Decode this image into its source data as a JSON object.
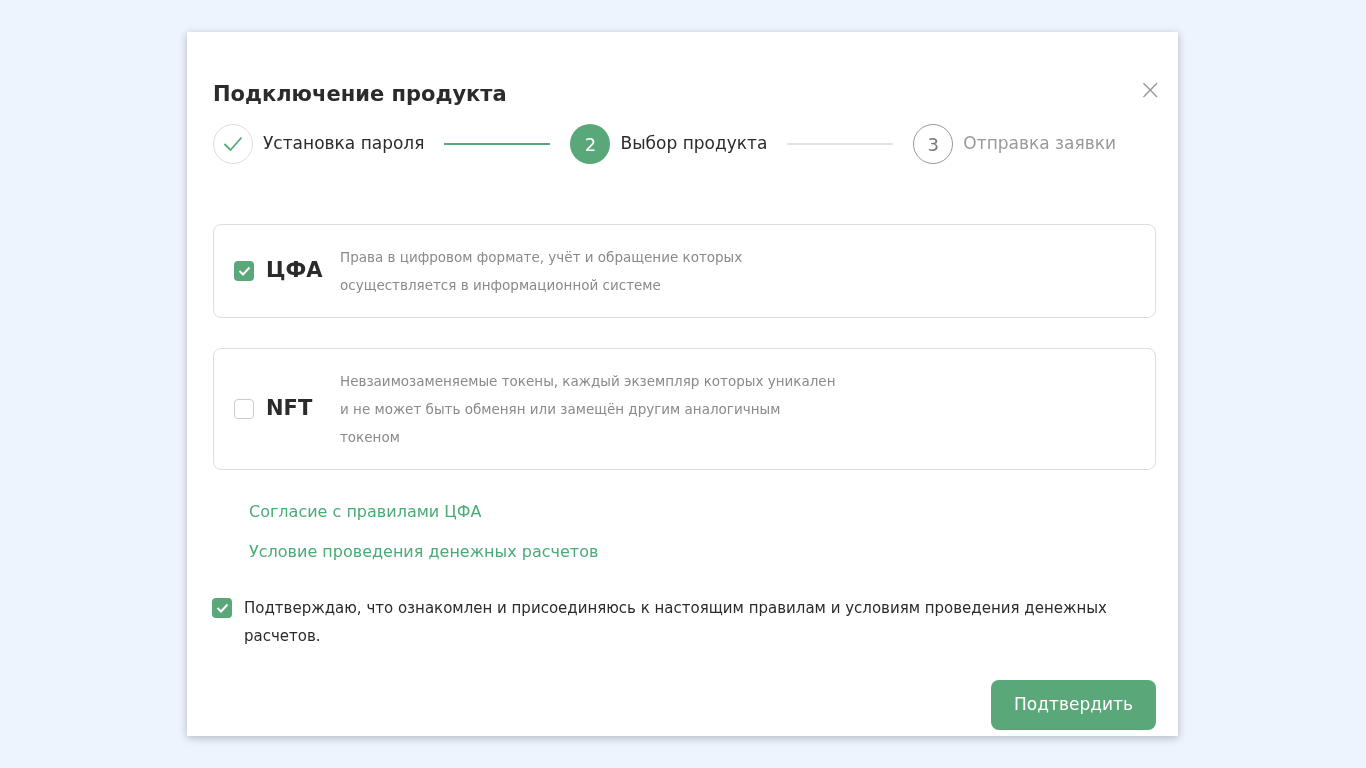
{
  "dialog": {
    "title": "Подключение продукта",
    "close": "×"
  },
  "steps": [
    {
      "label": "Установка пароля",
      "completed": true,
      "selected": false
    },
    {
      "number": "2",
      "label": "Выбор продукта",
      "completed": false,
      "selected": true
    },
    {
      "number": "3",
      "label": "Отправка заявки",
      "completed": false,
      "selected": false
    }
  ],
  "products": [
    {
      "name": "ЦФА",
      "checked": true,
      "description_lines": [
        "Права в цифровом формате, учёт и обращение которых",
        "осуществляется в информационной системе"
      ]
    },
    {
      "name": "NFT",
      "checked": false,
      "description_lines": [
        "Невзаимозаменяемые токены, каждый экземпляр которых уникален",
        "и не может быть обменян или замещён другим аналогичным",
        "токеном"
      ]
    }
  ],
  "links": [
    "Согласие с правилами ЦФА",
    "Условие проведения денежных расчетов"
  ],
  "agreement": {
    "checked": true,
    "text": "Подтверждаю, что ознакомлен и присоединяюсь к настоящим правилам и условиям проведения денежных расчетов."
  },
  "confirm_button": "Подтвердить"
}
